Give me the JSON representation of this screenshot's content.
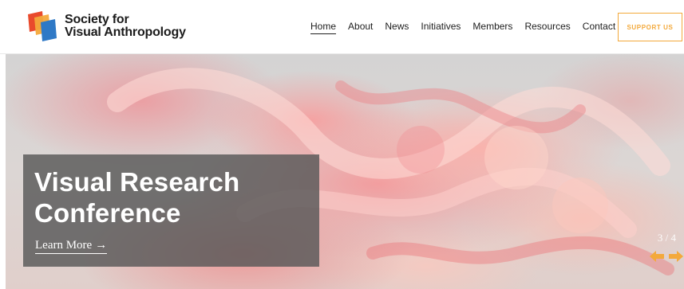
{
  "brand": {
    "line1": "Society for",
    "line2": "Visual Anthropology",
    "logo_icon": "overlapping-squares-logo",
    "colors": {
      "red": "#e94a2c",
      "orange": "#f3a93b",
      "blue": "#2f79c6"
    }
  },
  "nav": {
    "items": [
      {
        "label": "Home",
        "active": true
      },
      {
        "label": "About"
      },
      {
        "label": "News"
      },
      {
        "label": "Initiatives"
      },
      {
        "label": "Members"
      },
      {
        "label": "Resources"
      },
      {
        "label": "Contact"
      }
    ],
    "support_label": "SUPPORT US",
    "accent_color": "#f3a93b"
  },
  "hero": {
    "title": "Visual Research Conference",
    "link_label": "Learn More",
    "link_arrow": "→",
    "counter": "3 / 4",
    "prev_icon": "arrow-left-icon",
    "next_icon": "arrow-right-icon",
    "arrow_color": "#f3a93b",
    "overlay_color": "#585858"
  }
}
